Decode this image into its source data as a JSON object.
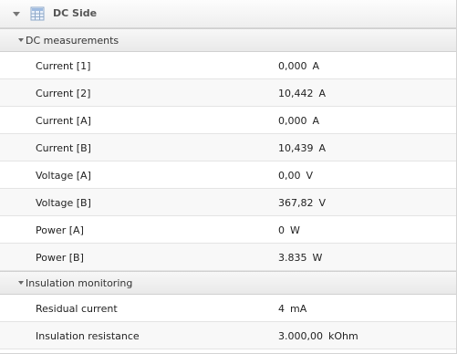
{
  "panel": {
    "title": "DC Side",
    "icon": "grid-table-icon"
  },
  "sections": [
    {
      "label": "DC measurements",
      "rows": [
        {
          "label": "Current [1]",
          "value": "0,000",
          "unit": "A"
        },
        {
          "label": "Current [2]",
          "value": "10,442",
          "unit": "A"
        },
        {
          "label": "Current [A]",
          "value": "0,000",
          "unit": "A"
        },
        {
          "label": "Current [B]",
          "value": "10,439",
          "unit": "A"
        },
        {
          "label": "Voltage [A]",
          "value": "0,00",
          "unit": "V"
        },
        {
          "label": "Voltage [B]",
          "value": "367,82",
          "unit": "V"
        },
        {
          "label": "Power [A]",
          "value": "0",
          "unit": "W"
        },
        {
          "label": "Power [B]",
          "value": "3.835",
          "unit": "W"
        }
      ]
    },
    {
      "label": "Insulation monitoring",
      "rows": [
        {
          "label": "Residual current",
          "value": "4",
          "unit": "mA"
        },
        {
          "label": "Insulation resistance",
          "value": "3.000,00",
          "unit": "kOhm"
        }
      ]
    }
  ]
}
